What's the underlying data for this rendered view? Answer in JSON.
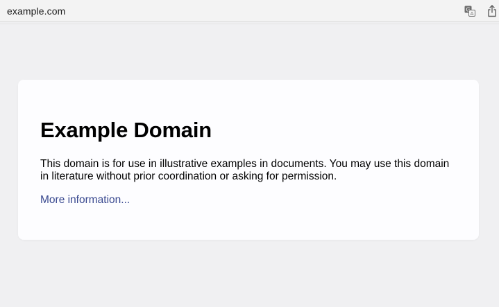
{
  "browser": {
    "url": "example.com",
    "translate_icon": "translate-icon",
    "share_icon": "share-icon"
  },
  "page": {
    "heading": "Example Domain",
    "description": "This domain is for use in illustrative examples in documents. You may use this domain in literature without prior coordination or asking for permission.",
    "link_label": "More information..."
  },
  "colors": {
    "background": "#f0f0f2",
    "card": "#fdfdff",
    "link": "#38488f"
  }
}
